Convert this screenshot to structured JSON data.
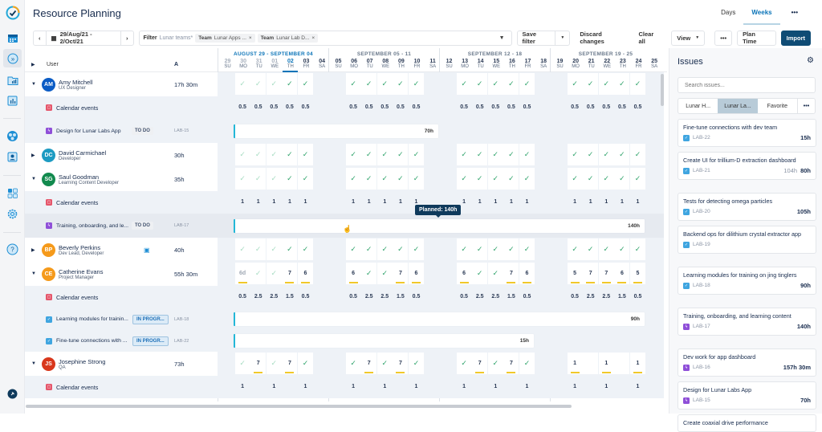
{
  "app": {
    "title": "Resource Planning"
  },
  "view_tabs": [
    {
      "label": "Days",
      "active": false
    },
    {
      "label": "Weeks",
      "active": true
    }
  ],
  "toolbar": {
    "date_range": "29/Aug/21 - 2/Oct/21",
    "filter_label": "Filter",
    "filter_value": "Lunar teams*",
    "chips": [
      {
        "key": "Team",
        "value": "Lunar Apps ..."
      },
      {
        "key": "Team",
        "value": "Lunar Lab D..."
      }
    ],
    "save_filter": "Save filter",
    "discard": "Discard changes",
    "clear_all": "Clear all",
    "view": "View",
    "more": "•••",
    "plan_time": "Plan Time",
    "import": "Import"
  },
  "columns": {
    "user": "User",
    "a": "A"
  },
  "weeks": [
    {
      "title": "AUGUST 29 - SEPTEMBER 04",
      "days": [
        [
          "29",
          "SU"
        ],
        [
          "30",
          "MO"
        ],
        [
          "31",
          "TU"
        ],
        [
          "01",
          "WE"
        ],
        [
          "02",
          "TH"
        ],
        [
          "03",
          "FR"
        ],
        [
          "04",
          "SA"
        ]
      ]
    },
    {
      "title": "SEPTEMBER 05 - 11",
      "days": [
        [
          "05",
          "SU"
        ],
        [
          "06",
          "MO"
        ],
        [
          "07",
          "TU"
        ],
        [
          "08",
          "WE"
        ],
        [
          "09",
          "TH"
        ],
        [
          "10",
          "FR"
        ],
        [
          "11",
          "SA"
        ]
      ]
    },
    {
      "title": "SEPTEMBER 12 - 18",
      "days": [
        [
          "12",
          "SU"
        ],
        [
          "13",
          "MO"
        ],
        [
          "14",
          "TU"
        ],
        [
          "15",
          "WE"
        ],
        [
          "16",
          "TH"
        ],
        [
          "17",
          "FR"
        ],
        [
          "18",
          "SA"
        ]
      ]
    },
    {
      "title": "SEPTEMBER 19 - 25",
      "days": [
        [
          "19",
          "SU"
        ],
        [
          "20",
          "MO"
        ],
        [
          "21",
          "TU"
        ],
        [
          "22",
          "WE"
        ],
        [
          "23",
          "TH"
        ],
        [
          "24",
          "FR"
        ],
        [
          "25",
          "SA"
        ]
      ]
    }
  ],
  "users": [
    {
      "initials": "AM",
      "name": "Amy Mitchell",
      "role": "UX Designer",
      "hours": "17h 30m",
      "color": "#0b5cc5",
      "expanded": true,
      "days": [
        "c",
        "c",
        "c",
        "C",
        "C",
        "C",
        "C",
        "C",
        "C",
        "C",
        "C",
        "C",
        "C",
        "C",
        "C",
        "C",
        "C",
        "C",
        "C",
        "C"
      ],
      "subs": [
        {
          "type": "calendar",
          "label": "Calendar events",
          "values": [
            "0.5",
            "0.5",
            "0.5",
            "0.5",
            "0.5",
            "0.5",
            "0.5",
            "0.5",
            "0.5",
            "0.5",
            "0.5",
            "0.5",
            "0.5",
            "0.5",
            "0.5",
            "0.5",
            "0.5",
            "0.5",
            "0.5",
            "0.5"
          ]
        },
        {
          "type": "task",
          "label": "Design for Lunar Labs App",
          "status": "TO DO",
          "key": "LAB-15",
          "bar": "70h"
        }
      ]
    },
    {
      "initials": "DC",
      "name": "David Carmichael",
      "role": "Developer",
      "hours": "30h",
      "color": "#1d9bc2",
      "expanded": false,
      "days": [
        "c",
        "c",
        "c",
        "C",
        "C",
        "C",
        "C",
        "C",
        "C",
        "C",
        "C",
        "C",
        "C",
        "C",
        "C",
        "C",
        "C",
        "C",
        "C",
        "C"
      ]
    },
    {
      "initials": "SG",
      "name": "Saul Goodman",
      "role": "Learning Content Developer",
      "hours": "35h",
      "color": "#128a4e",
      "expanded": true,
      "days": [
        "c",
        "c",
        "c",
        "C",
        "C",
        "C",
        "C",
        "C",
        "C",
        "C",
        "C",
        "C",
        "C",
        "C",
        "C",
        "C",
        "C",
        "C",
        "C",
        "C"
      ],
      "subs": [
        {
          "type": "calendar",
          "label": "Calendar events",
          "values": [
            "1",
            "1",
            "1",
            "1",
            "1",
            "1",
            "1",
            "1",
            "1",
            "1",
            "1",
            "1",
            "1",
            "1",
            "1",
            "1",
            "1",
            "1",
            "1",
            "1"
          ]
        },
        {
          "type": "task",
          "label": "Training, onboarding, and le...",
          "status": "TO DO",
          "key": "LAB-17",
          "bar": "140h"
        }
      ]
    },
    {
      "initials": "BP",
      "name": "Beverly Perkins",
      "role": "Dev Lead, Developer",
      "hours": "40h",
      "color": "#f59a1b",
      "expanded": false,
      "days": [
        "c",
        "c",
        "c",
        "C",
        "C",
        "C",
        "C",
        "C",
        "C",
        "C",
        "C",
        "C",
        "C",
        "C",
        "C",
        "C",
        "C",
        "C",
        "C",
        "C"
      ]
    },
    {
      "initials": "CE",
      "name": "Catherine Evans",
      "role": "Project Manager",
      "hours": "55h 30m",
      "color": "#f59a1b",
      "expanded": true,
      "days": [
        "6d",
        "c",
        "c",
        "7",
        "6",
        "6",
        "C",
        "C",
        "7",
        "6",
        "6",
        "C",
        "C",
        "7",
        "6",
        "5",
        "7",
        "7",
        "6",
        "5"
      ],
      "subs": [
        {
          "type": "calendar",
          "label": "Calendar events",
          "values": [
            "0.5",
            "2.5",
            "2.5",
            "1.5",
            "0.5",
            "0.5",
            "2.5",
            "2.5",
            "1.5",
            "0.5",
            "0.5",
            "2.5",
            "2.5",
            "1.5",
            "0.5",
            "0.5",
            "2.5",
            "2.5",
            "1.5",
            "0.5"
          ]
        },
        {
          "type": "story",
          "label": "Learning modules for trainin...",
          "status": "IN PROGR...",
          "key": "LAB-18",
          "bar": "90h"
        },
        {
          "type": "story",
          "label": "Fine-tune connections with ...",
          "status": "IN PROGR...",
          "key": "LAB-22",
          "bar": "15h"
        }
      ]
    },
    {
      "initials": "JS",
      "name": "Josephine Strong",
      "role": "QA",
      "hours": "73h",
      "color": "#d8371c",
      "expanded": true,
      "days": [
        "c",
        "7",
        "c",
        "7",
        "C",
        "C",
        "7",
        "C",
        "7",
        "C",
        "C",
        "7",
        "C",
        "7",
        "C",
        "1",
        "",
        "1",
        "",
        "1"
      ],
      "subs": [
        {
          "type": "calendar",
          "label": "Calendar events",
          "values": [
            "1",
            "",
            "1",
            "",
            "1",
            "1",
            "",
            "1",
            "",
            "1",
            "1",
            "",
            "1",
            "",
            "1",
            "1",
            "",
            "1",
            "",
            "1"
          ]
        }
      ]
    }
  ],
  "tooltip": "Planned: 140h",
  "issues_panel": {
    "title": "Issues",
    "search_placeholder": "Search issues...",
    "tabs": [
      {
        "label": "Lunar H...",
        "active": false
      },
      {
        "label": "Lunar La...",
        "active": true
      },
      {
        "label": "Favorite",
        "active": false
      },
      {
        "label": "•••",
        "active": false
      }
    ],
    "items": [
      {
        "title": "Fine-tune connections with dev team",
        "key": "LAB-22",
        "type": "story",
        "estimate": "",
        "hours": "15h"
      },
      {
        "title": "Create UI for trillium-D extraction dashboard",
        "key": "LAB-21",
        "type": "story",
        "estimate": "104h",
        "hours": "80h"
      },
      {
        "title": "Tests for detecting omega particles",
        "key": "LAB-20",
        "type": "story",
        "estimate": "",
        "hours": "105h"
      },
      {
        "title": "Backend ops for dilithium crystal extractor app",
        "key": "LAB-19",
        "type": "story",
        "estimate": "",
        "hours": ""
      },
      {
        "title": "Learning modules for training on jing tinglers",
        "key": "LAB-18",
        "type": "story",
        "estimate": "",
        "hours": "90h"
      },
      {
        "title": "Training, onboarding, and learning content",
        "key": "LAB-17",
        "type": "epic",
        "estimate": "",
        "hours": "140h"
      },
      {
        "title": "Dev work for app dashboard",
        "key": "LAB-16",
        "type": "epic",
        "estimate": "",
        "hours": "157h 30m"
      },
      {
        "title": "Design for Lunar Labs App",
        "key": "LAB-15",
        "type": "epic",
        "estimate": "",
        "hours": "70h"
      },
      {
        "title": "Create coaxial drive performance",
        "key": "",
        "type": "story",
        "estimate": "",
        "hours": ""
      }
    ]
  },
  "colors": {
    "accent": "#0b74b8",
    "primary_button": "#0f4c75",
    "check": "#2fa36b",
    "overbooked": "#f0c82a",
    "bar_edge": "#23b7d7"
  }
}
